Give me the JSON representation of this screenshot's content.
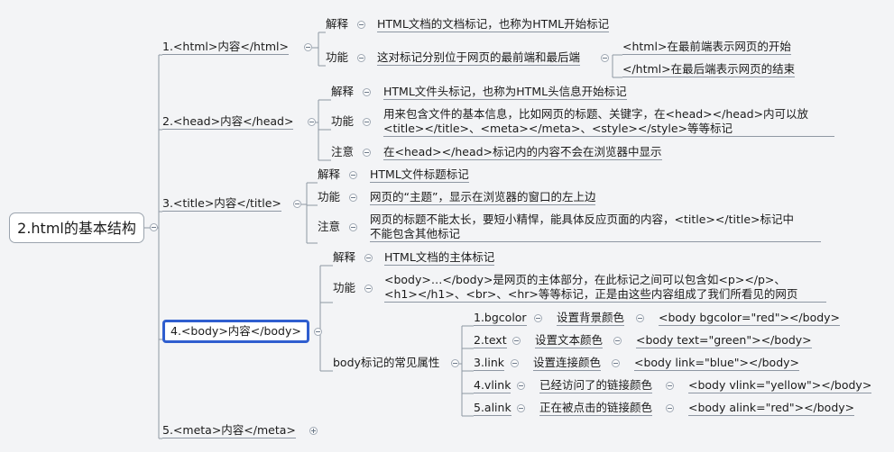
{
  "root": "2.html的基本结构",
  "b1": {
    "label": "1.<html>内容</html>",
    "jieshi": "解释",
    "jieshi_text": "HTML文档的文档标记，也称为HTML开始标记",
    "gongneng": "功能",
    "gongneng_text": "这对标记分别位于网页的最前端和最后端",
    "front": "<html>在最前端表示网页的开始",
    "back": "</html>在最后端表示网页的结束"
  },
  "b2": {
    "label": "2.<head>内容</head>",
    "jieshi": "解释",
    "jieshi_text": "HTML文件头标记，也称为HTML头信息开始标记",
    "gongneng": "功能",
    "gongneng_text1": "用来包含文件的基本信息，比如网页的标题、关键字，在<head></head>内可以放",
    "gongneng_text2": "<title></title>、<meta></meta>、<style></style>等等标记",
    "zhuyi": "注意",
    "zhuyi_text": "在<head></head>标记内的内容不会在浏览器中显示"
  },
  "b3": {
    "label": "3.<title>内容</title>",
    "jieshi": "解释",
    "jieshi_text": "HTML文件标题标记",
    "gongneng": "功能",
    "gongneng_text": "网页的“主题”，显示在浏览器的窗口的左上边",
    "zhuyi": "注意",
    "zhuyi_text1": "网页的标题不能太长，要短小精悍，能具体反应页面的内容，<title></title>标记中",
    "zhuyi_text2": "不能包含其他标记"
  },
  "b4": {
    "label": "4.<body>内容</body>",
    "jieshi": "解释",
    "jieshi_text": "HTML文档的主体标记",
    "gongneng": "功能",
    "gongneng_text1": "<body>…</body>是网页的主体部分，在此标记之间可以包含如<p></p>、",
    "gongneng_text2": "<h1></h1>、<br>、<hr>等等标记，正是由这些内容组成了我们所看见的网页",
    "attrs_label": "body标记的常见属性",
    "attrs": [
      {
        "name": "1.bgcolor",
        "desc": "设置背景颜色",
        "example": "<body bgcolor=\"red\"></body>"
      },
      {
        "name": "2.text",
        "desc": "设置文本颜色",
        "example": "<body text=\"green\"></body>"
      },
      {
        "name": "3.link",
        "desc": "设置连接颜色",
        "example": "<body link=\"blue\"></body>"
      },
      {
        "name": "4.vlink",
        "desc": "已经访问了的链接颜色",
        "example": "<body vlink=\"yellow\"></body>"
      },
      {
        "name": "5.alink",
        "desc": "正在被点击的链接颜色",
        "example": "<body alink=\"red\"></body>"
      }
    ]
  },
  "b5": {
    "label": "5.<meta>内容</meta>"
  },
  "colors": {
    "line": "#8e97a3",
    "selected": "#2f5ecf"
  }
}
